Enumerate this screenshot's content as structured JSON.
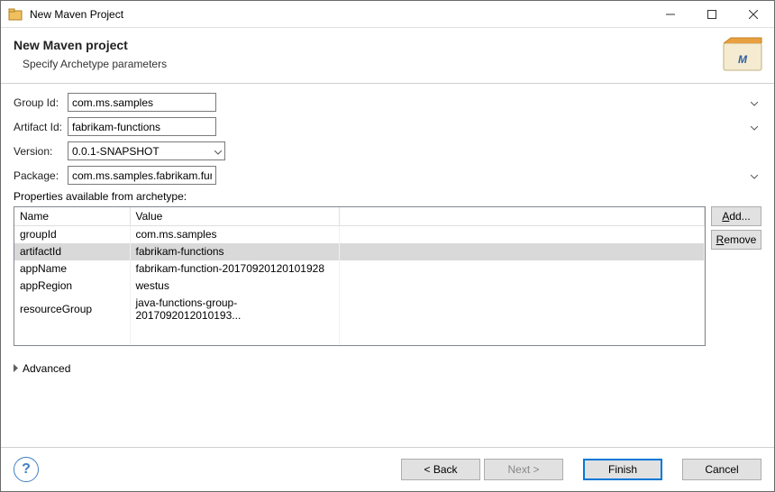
{
  "titlebar": {
    "title": "New Maven Project"
  },
  "header": {
    "title": "New Maven project",
    "subtitle": "Specify Archetype parameters"
  },
  "form": {
    "groupLabel": "Group Id:",
    "groupValue": "com.ms.samples",
    "artifactLabel": "Artifact Id:",
    "artifactValue": "fabrikam-functions",
    "versionLabel": "Version:",
    "versionValue": "0.0.1-SNAPSHOT",
    "packageLabel": "Package:",
    "packageValue": "com.ms.samples.fabrikam.functions"
  },
  "propsLabel": "Properties available from archetype:",
  "table": {
    "cols": [
      "Name",
      "Value",
      ""
    ],
    "rows": [
      {
        "name": "groupId",
        "value": "com.ms.samples",
        "sel": false
      },
      {
        "name": "artifactId",
        "value": "fabrikam-functions",
        "sel": true
      },
      {
        "name": "appName",
        "value": "fabrikam-function-20170920120101928",
        "sel": false
      },
      {
        "name": "appRegion",
        "value": "westus",
        "sel": false
      },
      {
        "name": "resourceGroup",
        "value": "java-functions-group-2017092012010193...",
        "sel": false
      }
    ]
  },
  "side": {
    "add": "Add...",
    "remove": "Remove"
  },
  "advanced": "Advanced",
  "footer": {
    "back": "< Back",
    "next": "Next >",
    "finish": "Finish",
    "cancel": "Cancel"
  }
}
